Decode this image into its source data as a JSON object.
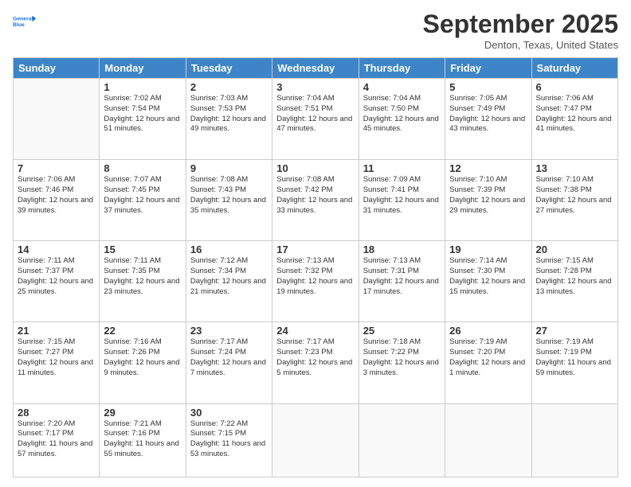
{
  "header": {
    "logo_line1": "General",
    "logo_line2": "Blue",
    "month": "September 2025",
    "location": "Denton, Texas, United States"
  },
  "days_of_week": [
    "Sunday",
    "Monday",
    "Tuesday",
    "Wednesday",
    "Thursday",
    "Friday",
    "Saturday"
  ],
  "weeks": [
    [
      {
        "day": "",
        "info": ""
      },
      {
        "day": "1",
        "info": "Sunrise: 7:02 AM\nSunset: 7:54 PM\nDaylight: 12 hours\nand 51 minutes."
      },
      {
        "day": "2",
        "info": "Sunrise: 7:03 AM\nSunset: 7:53 PM\nDaylight: 12 hours\nand 49 minutes."
      },
      {
        "day": "3",
        "info": "Sunrise: 7:04 AM\nSunset: 7:51 PM\nDaylight: 12 hours\nand 47 minutes."
      },
      {
        "day": "4",
        "info": "Sunrise: 7:04 AM\nSunset: 7:50 PM\nDaylight: 12 hours\nand 45 minutes."
      },
      {
        "day": "5",
        "info": "Sunrise: 7:05 AM\nSunset: 7:49 PM\nDaylight: 12 hours\nand 43 minutes."
      },
      {
        "day": "6",
        "info": "Sunrise: 7:06 AM\nSunset: 7:47 PM\nDaylight: 12 hours\nand 41 minutes."
      }
    ],
    [
      {
        "day": "7",
        "info": "Sunrise: 7:06 AM\nSunset: 7:46 PM\nDaylight: 12 hours\nand 39 minutes."
      },
      {
        "day": "8",
        "info": "Sunrise: 7:07 AM\nSunset: 7:45 PM\nDaylight: 12 hours\nand 37 minutes."
      },
      {
        "day": "9",
        "info": "Sunrise: 7:08 AM\nSunset: 7:43 PM\nDaylight: 12 hours\nand 35 minutes."
      },
      {
        "day": "10",
        "info": "Sunrise: 7:08 AM\nSunset: 7:42 PM\nDaylight: 12 hours\nand 33 minutes."
      },
      {
        "day": "11",
        "info": "Sunrise: 7:09 AM\nSunset: 7:41 PM\nDaylight: 12 hours\nand 31 minutes."
      },
      {
        "day": "12",
        "info": "Sunrise: 7:10 AM\nSunset: 7:39 PM\nDaylight: 12 hours\nand 29 minutes."
      },
      {
        "day": "13",
        "info": "Sunrise: 7:10 AM\nSunset: 7:38 PM\nDaylight: 12 hours\nand 27 minutes."
      }
    ],
    [
      {
        "day": "14",
        "info": "Sunrise: 7:11 AM\nSunset: 7:37 PM\nDaylight: 12 hours\nand 25 minutes."
      },
      {
        "day": "15",
        "info": "Sunrise: 7:11 AM\nSunset: 7:35 PM\nDaylight: 12 hours\nand 23 minutes."
      },
      {
        "day": "16",
        "info": "Sunrise: 7:12 AM\nSunset: 7:34 PM\nDaylight: 12 hours\nand 21 minutes."
      },
      {
        "day": "17",
        "info": "Sunrise: 7:13 AM\nSunset: 7:32 PM\nDaylight: 12 hours\nand 19 minutes."
      },
      {
        "day": "18",
        "info": "Sunrise: 7:13 AM\nSunset: 7:31 PM\nDaylight: 12 hours\nand 17 minutes."
      },
      {
        "day": "19",
        "info": "Sunrise: 7:14 AM\nSunset: 7:30 PM\nDaylight: 12 hours\nand 15 minutes."
      },
      {
        "day": "20",
        "info": "Sunrise: 7:15 AM\nSunset: 7:28 PM\nDaylight: 12 hours\nand 13 minutes."
      }
    ],
    [
      {
        "day": "21",
        "info": "Sunrise: 7:15 AM\nSunset: 7:27 PM\nDaylight: 12 hours\nand 11 minutes."
      },
      {
        "day": "22",
        "info": "Sunrise: 7:16 AM\nSunset: 7:26 PM\nDaylight: 12 hours\nand 9 minutes."
      },
      {
        "day": "23",
        "info": "Sunrise: 7:17 AM\nSunset: 7:24 PM\nDaylight: 12 hours\nand 7 minutes."
      },
      {
        "day": "24",
        "info": "Sunrise: 7:17 AM\nSunset: 7:23 PM\nDaylight: 12 hours\nand 5 minutes."
      },
      {
        "day": "25",
        "info": "Sunrise: 7:18 AM\nSunset: 7:22 PM\nDaylight: 12 hours\nand 3 minutes."
      },
      {
        "day": "26",
        "info": "Sunrise: 7:19 AM\nSunset: 7:20 PM\nDaylight: 12 hours\nand 1 minute."
      },
      {
        "day": "27",
        "info": "Sunrise: 7:19 AM\nSunset: 7:19 PM\nDaylight: 11 hours\nand 59 minutes."
      }
    ],
    [
      {
        "day": "28",
        "info": "Sunrise: 7:20 AM\nSunset: 7:17 PM\nDaylight: 11 hours\nand 57 minutes."
      },
      {
        "day": "29",
        "info": "Sunrise: 7:21 AM\nSunset: 7:16 PM\nDaylight: 11 hours\nand 55 minutes."
      },
      {
        "day": "30",
        "info": "Sunrise: 7:22 AM\nSunset: 7:15 PM\nDaylight: 11 hours\nand 53 minutes."
      },
      {
        "day": "",
        "info": ""
      },
      {
        "day": "",
        "info": ""
      },
      {
        "day": "",
        "info": ""
      },
      {
        "day": "",
        "info": ""
      }
    ]
  ]
}
